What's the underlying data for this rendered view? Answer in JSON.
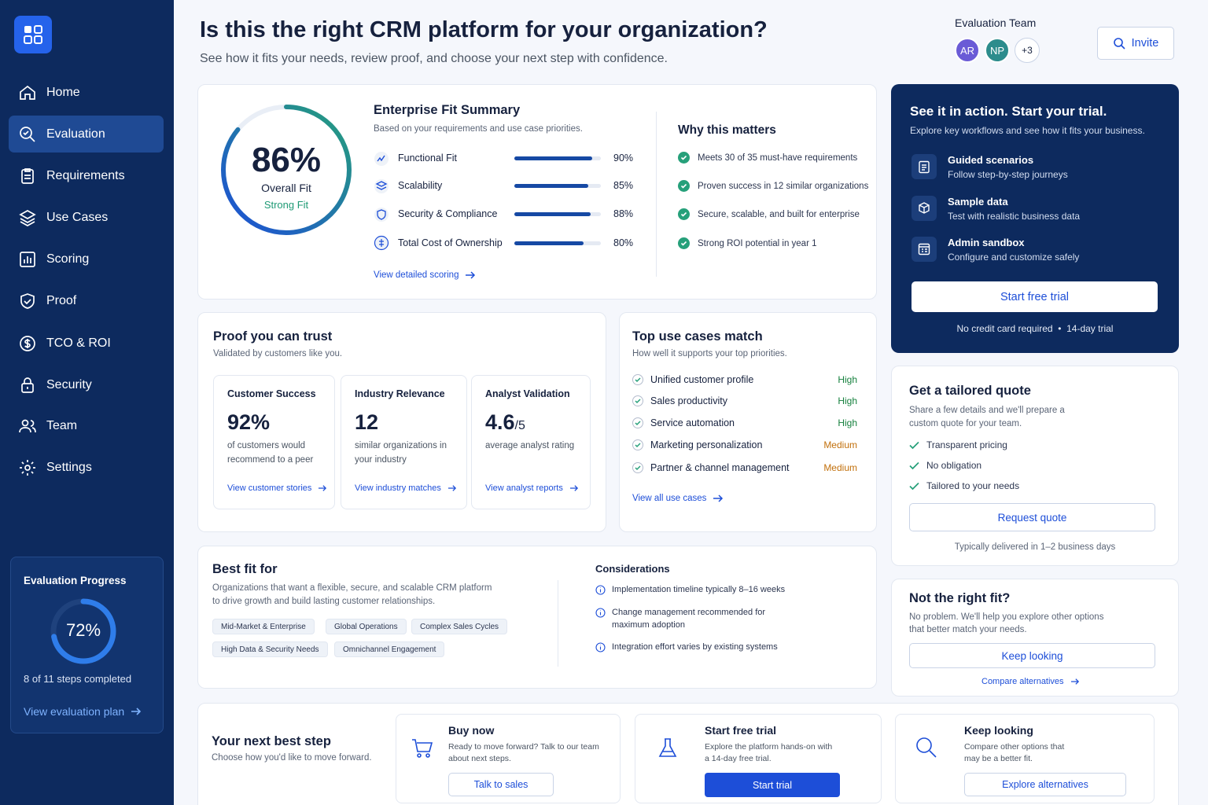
{
  "sidebar": {
    "items": [
      {
        "label": "Home",
        "icon": "home-icon"
      },
      {
        "label": "Evaluation",
        "icon": "evaluation-icon",
        "active": true
      },
      {
        "label": "Requirements",
        "icon": "clipboard-icon"
      },
      {
        "label": "Use Cases",
        "icon": "layers-icon"
      },
      {
        "label": "Scoring",
        "icon": "bar-chart-icon"
      },
      {
        "label": "Proof",
        "icon": "shield-check-icon"
      },
      {
        "label": "TCO & ROI",
        "icon": "dollar-icon"
      },
      {
        "label": "Security",
        "icon": "lock-icon"
      },
      {
        "label": "Team",
        "icon": "users-icon"
      },
      {
        "label": "Settings",
        "icon": "gear-icon"
      }
    ],
    "progress": {
      "title": "Evaluation Progress",
      "percent_text": "72%",
      "percent": 72,
      "steps_text": "8 of 11 steps completed",
      "link": "View evaluation plan"
    }
  },
  "header": {
    "title": "Is this the right CRM platform for your organization?",
    "subtitle": "See how it fits your needs, review proof, and choose your next step with confidence.",
    "team_label": "Evaluation Team",
    "avatars": [
      "AR",
      "NP",
      "+3"
    ],
    "invite_label": "Invite"
  },
  "fit": {
    "score_text": "86%",
    "score": 86,
    "overall_label": "Overall Fit",
    "strength": "Strong Fit",
    "title": "Enterprise Fit Summary",
    "subtitle": "Based on your requirements and use case priorities.",
    "rows": [
      {
        "label": "Functional Fit",
        "value_text": "90%",
        "value": 90
      },
      {
        "label": "Scalability",
        "value_text": "85%",
        "value": 85
      },
      {
        "label": "Security & Compliance",
        "value_text": "88%",
        "value": 88
      },
      {
        "label": "Total Cost of Ownership",
        "value_text": "80%",
        "value": 80
      }
    ],
    "link": "View detailed scoring",
    "why_title": "Why this matters",
    "why": [
      "Meets 30 of 35 must-have requirements",
      "Proven success in 12 similar organizations",
      "Secure, scalable, and built for enterprise",
      "Strong ROI potential in year 1"
    ]
  },
  "trial": {
    "title": "See it in action. Start your trial.",
    "subtitle": "Explore key workflows and see how it fits your business.",
    "features": [
      {
        "title": "Guided scenarios",
        "desc": "Follow step-by-step journeys"
      },
      {
        "title": "Sample data",
        "desc": "Test with realistic business data"
      },
      {
        "title": "Admin sandbox",
        "desc": "Configure and customize safely"
      }
    ],
    "button": "Start free trial",
    "note": "No credit card required  •  14-day trial"
  },
  "proof": {
    "title": "Proof you can trust",
    "subtitle": "Validated by customers like you.",
    "cards": [
      {
        "title": "Customer Success",
        "big": "92%",
        "suffix": "",
        "desc": "of customers would recommend to a peer",
        "link": "View customer stories"
      },
      {
        "title": "Industry Relevance",
        "big": "12",
        "suffix": "",
        "desc": "similar organizations in your industry",
        "link": "View industry matches"
      },
      {
        "title": "Analyst Validation",
        "big": "4.6",
        "suffix": "/5",
        "desc": "average analyst rating",
        "link": "View analyst reports"
      }
    ]
  },
  "use_cases": {
    "title": "Top use cases match",
    "subtitle": "How well it supports your top priorities.",
    "items": [
      {
        "label": "Unified customer profile",
        "level": "High"
      },
      {
        "label": "Sales productivity",
        "level": "High"
      },
      {
        "label": "Service automation",
        "level": "High"
      },
      {
        "label": "Marketing personalization",
        "level": "Medium"
      },
      {
        "label": "Partner & channel management",
        "level": "Medium"
      }
    ],
    "link": "View all use cases",
    "colors": {
      "High": "#15803d",
      "Medium": "#c2700c"
    }
  },
  "quote": {
    "title": "Get a tailored quote",
    "subtitle": "Share a few details and we'll prepare a custom quote for your team.",
    "checks": [
      "Transparent pricing",
      "No obligation",
      "Tailored to your needs"
    ],
    "button": "Request quote",
    "note": "Typically delivered in 1–2 business days"
  },
  "best_fit": {
    "title": "Best fit for",
    "desc": "Organizations that want a flexible, secure, and scalable CRM platform to drive growth and build lasting customer relationships.",
    "chips": [
      "Mid-Market & Enterprise",
      "Global Operations",
      "Complex Sales Cycles",
      "High Data & Security Needs",
      "Omnichannel Engagement"
    ],
    "considerations_title": "Considerations",
    "considerations": [
      "Implementation timeline typically 8–16 weeks",
      "Change management recommended for maximum adoption",
      "Integration effort varies by existing systems"
    ]
  },
  "not_fit": {
    "title": "Not the right fit?",
    "subtitle": "No problem. We'll help you explore other options that better match your needs.",
    "button": "Keep looking",
    "link": "Compare alternatives"
  },
  "next_step": {
    "title": "Your next best step",
    "subtitle": "Choose how you'd like to move forward.",
    "options": [
      {
        "title": "Buy now",
        "desc": "Ready to move forward? Talk to our team about next steps.",
        "button": "Talk to sales",
        "icon": "cart-icon"
      },
      {
        "title": "Start free trial",
        "desc": "Explore the platform hands-on with a 14-day free trial.",
        "button": "Start trial",
        "icon": "flask-icon"
      },
      {
        "title": "Keep looking",
        "desc": "Compare other options that may be a better fit.",
        "button": "Explore alternatives",
        "icon": "search-icon"
      }
    ]
  },
  "colors": {
    "sidebar": "#0d2a5e",
    "accent": "#1d4ed8",
    "success": "#26a07a"
  }
}
